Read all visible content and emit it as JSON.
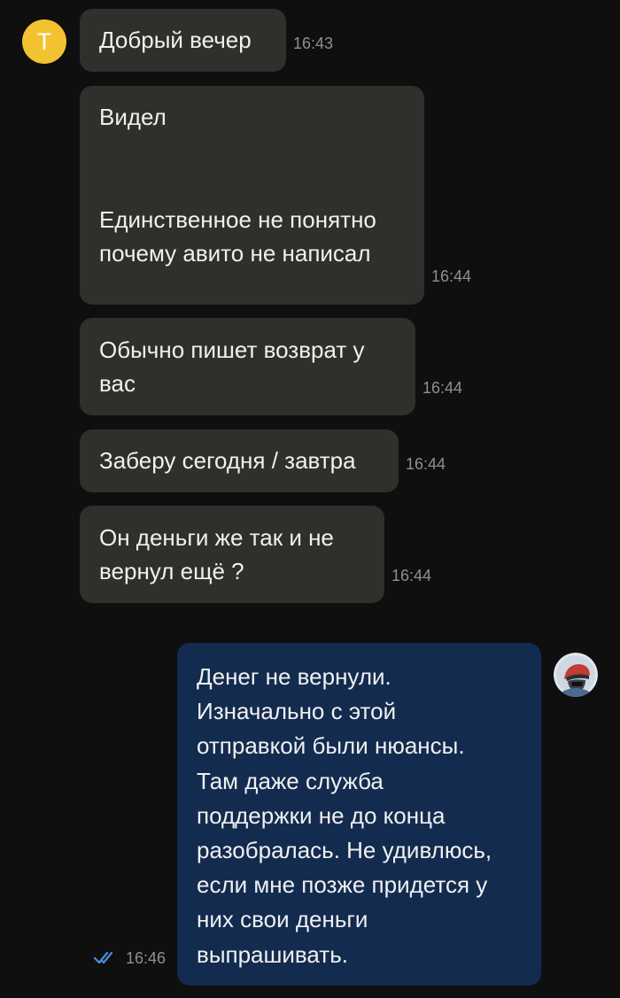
{
  "contact": {
    "avatar_letter": "T",
    "avatar_color": "#f2c230"
  },
  "incoming": [
    {
      "text": "Добрый вечер",
      "time": "16:43"
    },
    {
      "text": "Видел\n\n\nЕдинственное не понятно\nпочему авито не написал",
      "time": "16:44"
    },
    {
      "text": "Обычно пишет возврат у\nвас",
      "time": "16:44"
    },
    {
      "text": "Заберу сегодня / завтра",
      "time": "16:44"
    },
    {
      "text": "Он деньги же так и не\nвернул ещё ?",
      "time": "16:44"
    }
  ],
  "outgoing": {
    "lines": [
      "Денег не вернули.",
      "Изначально с этой",
      "отправкой были нюансы.",
      "Там даже служба",
      "поддержки не до конца",
      "разобралась. Не удивлюсь,",
      "если мне позже придется у",
      "них свои деньги",
      "выпрашивать."
    ],
    "time": "16:46",
    "status_icon": "double-check-icon",
    "status_color": "#4a90d9"
  },
  "colors": {
    "background": "#0f0f10",
    "incoming_bubble": "#312f2b",
    "outgoing_bubble": "#132b4f",
    "timestamp": "#8f8f93"
  }
}
